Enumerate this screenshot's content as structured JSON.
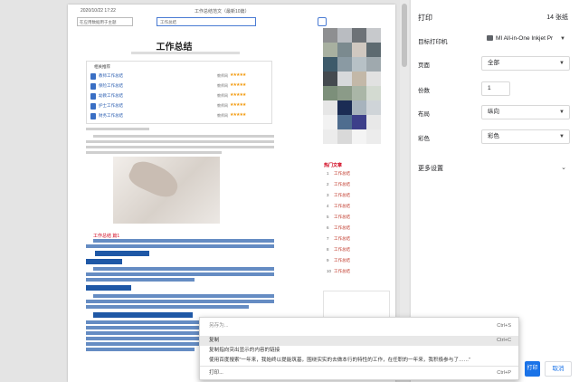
{
  "paper": {
    "header_date": "2020/10/22 17:22",
    "header_title": "工作总结范文（最新10篇）",
    "site_select": "在应用数据用于主题",
    "search_text": "工作总结",
    "doc_title": "工作总结",
    "toc_head": "相关推荐",
    "toc": [
      {
        "link": "教师工作总结",
        "tag": "教师网",
        "stars": "★★★★★"
      },
      {
        "link": "保险工作总结",
        "tag": "教师网",
        "stars": "★★★★★"
      },
      {
        "link": "幼教工作总结",
        "tag": "教师网",
        "stars": "★★★★★"
      },
      {
        "link": "护士工作总结",
        "tag": "教师网",
        "stars": "★★★★★"
      },
      {
        "link": "财务工作总结",
        "tag": "教师网",
        "stars": "★★★★★"
      }
    ],
    "red_title": "工作总结 篇1",
    "right_head": "热门文章",
    "right_list": [
      {
        "n": "1",
        "t": "工作总结"
      },
      {
        "n": "2",
        "t": "工作总结"
      },
      {
        "n": "3",
        "t": "工作总结"
      },
      {
        "n": "4",
        "t": "工作总结"
      },
      {
        "n": "5",
        "t": "工作总结"
      },
      {
        "n": "6",
        "t": "工作总结"
      },
      {
        "n": "7",
        "t": "工作总结"
      },
      {
        "n": "8",
        "t": "工作总结"
      },
      {
        "n": "9",
        "t": "工作总结"
      },
      {
        "n": "10",
        "t": "工作总结"
      }
    ]
  },
  "settings": {
    "title": "打印",
    "pages_count": "14 张纸",
    "rows": [
      {
        "label": "目标打印机",
        "value": "MI All-in-One Inkjet Pr"
      },
      {
        "label": "页面",
        "value": "全部"
      },
      {
        "label": "份数",
        "value": "1"
      },
      {
        "label": "布局",
        "value": "纵向"
      },
      {
        "label": "彩色",
        "value": "彩色"
      }
    ],
    "more": "更多设置",
    "print_btn": "打印",
    "cancel_btn": "取消"
  },
  "context_menu": {
    "items": [
      {
        "label": "另存为...",
        "shortcut": "Ctrl+S"
      },
      {
        "label": "复制",
        "shortcut": "Ctrl+C"
      },
      {
        "label": "复制指向突出显示的内容的链接",
        "shortcut": ""
      },
      {
        "label": "使用百度搜索“一年来，我始终以提能筑基，围绕实实的去做本行的特性的工作，在任职的一年来，我积极参与了……”",
        "shortcut": ""
      },
      {
        "label": "打印...",
        "shortcut": "Ctrl+P"
      }
    ]
  },
  "colors": {
    "accent": "#1a73e8",
    "link": "#2a5db0",
    "red": "#d0021b",
    "highlight": "#1f58a6"
  }
}
